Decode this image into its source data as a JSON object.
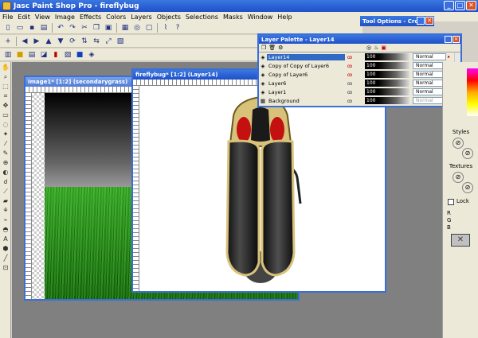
{
  "app": {
    "title": "Jasc Paint Shop Pro - fireflybug",
    "controls": {
      "minimize": "_",
      "maximize": "□",
      "close": "✕"
    }
  },
  "menu": [
    "File",
    "Edit",
    "View",
    "Image",
    "Effects",
    "Colors",
    "Layers",
    "Objects",
    "Selections",
    "Masks",
    "Window",
    "Help"
  ],
  "toolbar_icons": {
    "row1": [
      "new-icon",
      "open-icon",
      "save-icon",
      "print-icon",
      "undo-icon",
      "redo-icon",
      "cut-icon",
      "copy-icon",
      "paste-icon",
      "browse-icon",
      "capture-icon",
      "full-screen-icon",
      "script-icon",
      "help-icon"
    ],
    "row2": [
      "crop-plus-icon",
      "arrow-left-icon",
      "arrow-right-icon",
      "arrow-up-icon",
      "arrow-down-icon",
      "rotate-icon",
      "flip-icon",
      "mirror-icon",
      "resize-icon",
      "canvas-icon"
    ],
    "row3": [
      "tool-palette-icon",
      "color-palette-icon",
      "layer-palette-icon",
      "overview-icon",
      "histogram-icon",
      "script-output-icon",
      "browser-icon",
      "effects-icon"
    ]
  },
  "tool_options": {
    "title": "Tool Options - Crop",
    "close": "✕"
  },
  "documents": [
    {
      "title": "Image1* [1:2] (secondarygrass)"
    },
    {
      "title": "fireflybug* [1:2] (Layer14)"
    }
  ],
  "layer_palette": {
    "title": "Layer Palette - Layer14",
    "close": "✕",
    "layers": [
      {
        "name": "Layer14",
        "opacity": "100",
        "blend": "Normal",
        "selected": true
      },
      {
        "name": "Copy of Copy of Layer6",
        "opacity": "100",
        "blend": "Normal",
        "selected": false
      },
      {
        "name": "Copy of Layer6",
        "opacity": "100",
        "blend": "Normal",
        "selected": false
      },
      {
        "name": "Layer6",
        "opacity": "100",
        "blend": "Normal",
        "selected": false
      },
      {
        "name": "Layer1",
        "opacity": "100",
        "blend": "Normal",
        "selected": false
      },
      {
        "name": "Background",
        "opacity": "100",
        "blend": "Normal",
        "selected": false
      }
    ]
  },
  "right_panel": {
    "styles_label": "Styles",
    "textures_label": "Textures",
    "lock_label": "Lock",
    "rgb": [
      "R",
      "G",
      "B"
    ]
  }
}
